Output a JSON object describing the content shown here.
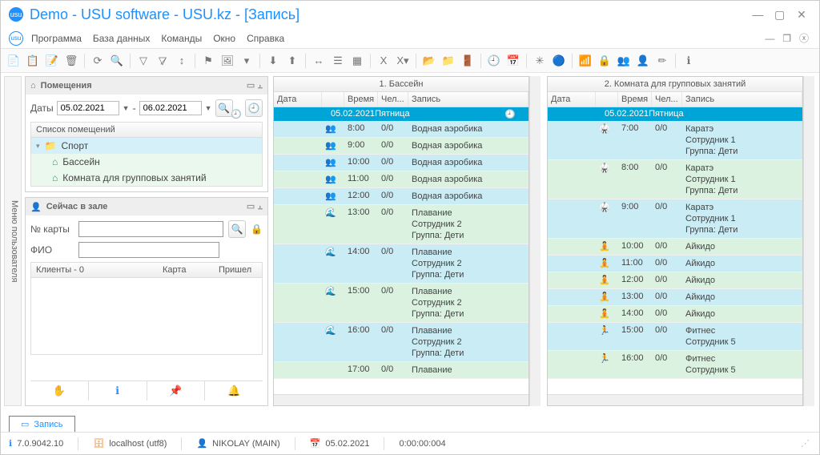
{
  "window": {
    "title": "Demo - USU software - USU.kz - [Запись]"
  },
  "menu": {
    "items": [
      "Программа",
      "База данных",
      "Команды",
      "Окно",
      "Справка"
    ]
  },
  "sidetab": "Меню пользователя",
  "rooms_panel": {
    "title": "Помещения",
    "dates_label": "Даты",
    "date_from": "05.02.2021",
    "date_to": "06.02.2021",
    "list_header": "Список помещений",
    "tree": {
      "root": "Спорт",
      "items": [
        "Бассейн",
        "Комната для групповых занятий"
      ]
    }
  },
  "now_panel": {
    "title": "Сейчас в зале",
    "card_label": "№ карты",
    "fio_label": "ФИО",
    "clients_header": "Клиенты - 0",
    "cols": {
      "card": "Карта",
      "came": "Пришел"
    }
  },
  "schedule_cols": {
    "date": "Дата",
    "time": "Время",
    "people": "Чел...",
    "record": "Запись"
  },
  "sched1": {
    "title": "1. Бассейн",
    "day_date": "05.02.2021",
    "day_name": "Пятница",
    "rows": [
      {
        "c": "blue",
        "icon": "👥",
        "time": "8:00",
        "p": "0/0",
        "rec": "Водная аэробика"
      },
      {
        "c": "green",
        "icon": "👥",
        "time": "9:00",
        "p": "0/0",
        "rec": "Водная аэробика"
      },
      {
        "c": "blue",
        "icon": "👥",
        "time": "10:00",
        "p": "0/0",
        "rec": "Водная аэробика"
      },
      {
        "c": "green",
        "icon": "👥",
        "time": "11:00",
        "p": "0/0",
        "rec": "Водная аэробика"
      },
      {
        "c": "blue",
        "icon": "👥",
        "time": "12:00",
        "p": "0/0",
        "rec": "Водная аэробика"
      },
      {
        "c": "green",
        "icon": "🌊",
        "time": "13:00",
        "p": "0/0",
        "rec": "Плавание\nСотрудник 2\nГруппа: Дети"
      },
      {
        "c": "blue",
        "icon": "🌊",
        "time": "14:00",
        "p": "0/0",
        "rec": "Плавание\nСотрудник 2\nГруппа: Дети"
      },
      {
        "c": "green",
        "icon": "🌊",
        "time": "15:00",
        "p": "0/0",
        "rec": "Плавание\nСотрудник 2\nГруппа: Дети"
      },
      {
        "c": "blue",
        "icon": "🌊",
        "time": "16:00",
        "p": "0/0",
        "rec": "Плавание\nСотрудник 2\nГруппа: Дети"
      },
      {
        "c": "green",
        "icon": "",
        "time": "17:00",
        "p": "0/0",
        "rec": "Плавание"
      }
    ]
  },
  "sched2": {
    "title": "2. Комната для групповых занятий",
    "day_date": "05.02.2021",
    "day_name": "Пятница",
    "rows": [
      {
        "c": "blue",
        "icon": "🥋",
        "time": "7:00",
        "p": "0/0",
        "rec": "Каратэ\nСотрудник 1\nГруппа: Дети"
      },
      {
        "c": "green",
        "icon": "🥋",
        "time": "8:00",
        "p": "0/0",
        "rec": "Каратэ\nСотрудник 1\nГруппа: Дети"
      },
      {
        "c": "blue",
        "icon": "🥋",
        "time": "9:00",
        "p": "0/0",
        "rec": "Каратэ\nСотрудник 1\nГруппа: Дети"
      },
      {
        "c": "green",
        "icon": "🧘",
        "time": "10:00",
        "p": "0/0",
        "rec": "Айкидо"
      },
      {
        "c": "blue",
        "icon": "🧘",
        "time": "11:00",
        "p": "0/0",
        "rec": "Айкидо"
      },
      {
        "c": "green",
        "icon": "🧘",
        "time": "12:00",
        "p": "0/0",
        "rec": "Айкидо"
      },
      {
        "c": "blue",
        "icon": "🧘",
        "time": "13:00",
        "p": "0/0",
        "rec": "Айкидо"
      },
      {
        "c": "green",
        "icon": "🧘",
        "time": "14:00",
        "p": "0/0",
        "rec": "Айкидо"
      },
      {
        "c": "blue",
        "icon": "🏃",
        "time": "15:00",
        "p": "0/0",
        "rec": "Фитнес\nСотрудник 5"
      },
      {
        "c": "green",
        "icon": "🏃",
        "time": "16:00",
        "p": "0/0",
        "rec": "Фитнес\nСотрудник 5"
      }
    ]
  },
  "tab": {
    "label": "Запись"
  },
  "status": {
    "version": "7.0.9042.10",
    "server": "localhost (utf8)",
    "user": "NIKOLAY (MAIN)",
    "date": "05.02.2021",
    "timer": "0:00:00:004"
  }
}
